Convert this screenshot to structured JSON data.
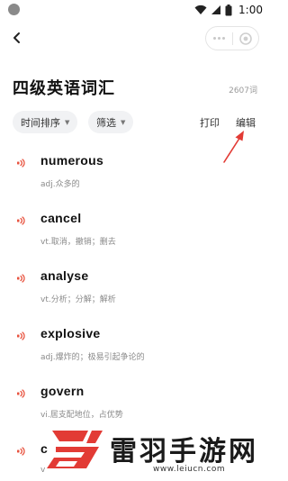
{
  "status_bar": {
    "time": "1:00",
    "icons": [
      "wifi-icon",
      "signal-icon",
      "battery-icon"
    ]
  },
  "nav": {
    "back_icon": "chevron-left-icon",
    "capsule": {
      "more_icon": "more-dots-icon",
      "close_icon": "target-close-icon"
    }
  },
  "page": {
    "title": "四级英语词汇",
    "count": "2607词"
  },
  "toolbar": {
    "sort_label": "时间排序",
    "filter_label": "筛选",
    "print_label": "打印",
    "edit_label": "编辑"
  },
  "words": [
    {
      "word": "numerous",
      "definition": "adj.众多的"
    },
    {
      "word": "cancel",
      "definition": "vt.取消，撤销；删去"
    },
    {
      "word": "analyse",
      "definition": "vt.分析；分解；解析"
    },
    {
      "word": "explosive",
      "definition": "adj.爆炸的；极易引起争论的"
    },
    {
      "word": "govern",
      "definition": "vi.居支配地位，占优势"
    },
    {
      "word": "c",
      "definition": "v"
    }
  ],
  "watermark": {
    "text": "雷羽手游网",
    "url": "www.leiucn.com"
  },
  "colors": {
    "accent_red": "#e23b35",
    "speaker_red": "#e8533f",
    "pill_bg": "#f1f2f4"
  }
}
